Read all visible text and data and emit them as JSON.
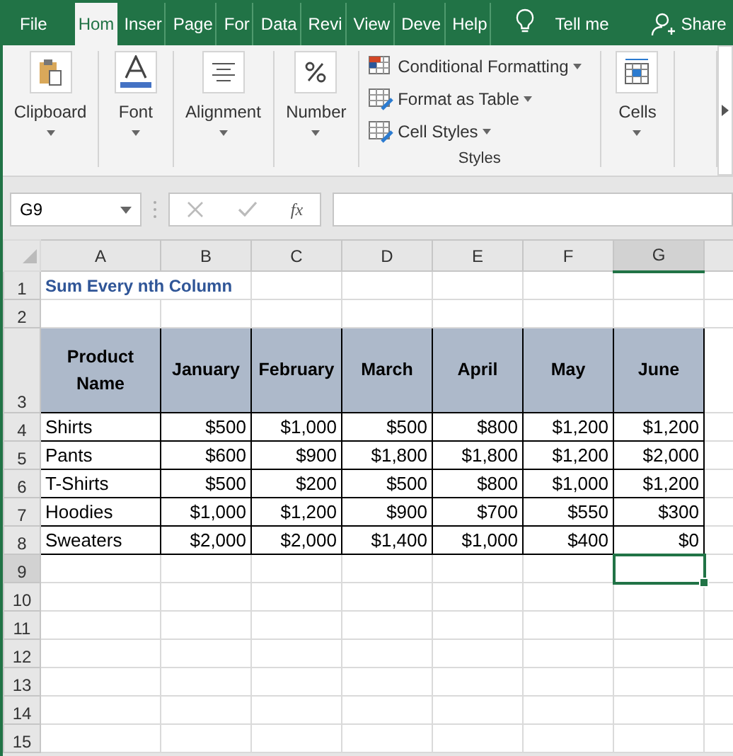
{
  "ribbon_tabs": [
    {
      "label": "File",
      "selected": false
    },
    {
      "label": "Hom",
      "selected": true
    },
    {
      "label": "Inser",
      "selected": false
    },
    {
      "label": "Page",
      "selected": false
    },
    {
      "label": "For",
      "selected": false
    },
    {
      "label": "Data",
      "selected": false
    },
    {
      "label": "Revi",
      "selected": false
    },
    {
      "label": "View",
      "selected": false
    },
    {
      "label": "Deve",
      "selected": false
    },
    {
      "label": "Help",
      "selected": false
    }
  ],
  "tell_me": "Tell me",
  "share": "Share",
  "ribbon_groups": [
    {
      "kind": "clipboard",
      "label": "Clipboard"
    },
    {
      "kind": "font",
      "label": "Font"
    },
    {
      "kind": "alignment",
      "label": "Alignment"
    },
    {
      "kind": "number",
      "label": "Number"
    },
    {
      "kind": "styles",
      "label": "Styles",
      "items": [
        "Conditional Formatting",
        "Format as Table",
        "Cell Styles"
      ]
    },
    {
      "kind": "cells",
      "label": "Cells"
    }
  ],
  "name_box": "G9",
  "function_symbol": "fx",
  "sheet": {
    "columns": [
      {
        "label": "A",
        "selected": false
      },
      {
        "label": "B",
        "selected": false
      },
      {
        "label": "C",
        "selected": false
      },
      {
        "label": "D",
        "selected": false
      },
      {
        "label": "E",
        "selected": false
      },
      {
        "label": "F",
        "selected": false
      },
      {
        "label": "G",
        "selected": true
      }
    ],
    "rows": [
      {
        "number": "1",
        "selected": false,
        "kind": "title",
        "cells": [
          "Sum Every nth Column"
        ]
      },
      {
        "number": "2",
        "selected": false,
        "kind": "blank"
      },
      {
        "number": "3",
        "selected": false,
        "kind": "header",
        "cells": [
          "Product Name",
          "January",
          "February",
          "March",
          "April",
          "May",
          "June"
        ]
      },
      {
        "number": "4",
        "selected": false,
        "kind": "data",
        "cells": [
          "Shirts",
          "$500",
          "$1,000",
          "$500",
          "$800",
          "$1,200",
          "$1,200"
        ]
      },
      {
        "number": "5",
        "selected": false,
        "kind": "data",
        "cells": [
          "Pants",
          "$600",
          "$900",
          "$1,800",
          "$1,800",
          "$1,200",
          "$2,000"
        ]
      },
      {
        "number": "6",
        "selected": false,
        "kind": "data",
        "cells": [
          "T-Shirts",
          "$500",
          "$200",
          "$500",
          "$800",
          "$1,000",
          "$1,200"
        ]
      },
      {
        "number": "7",
        "selected": false,
        "kind": "data",
        "cells": [
          "Hoodies",
          "$1,000",
          "$1,200",
          "$900",
          "$700",
          "$550",
          "$300"
        ]
      },
      {
        "number": "8",
        "selected": false,
        "kind": "data",
        "cells": [
          "Sweaters",
          "$2,000",
          "$2,000",
          "$1,400",
          "$1,000",
          "$400",
          "$0"
        ]
      },
      {
        "number": "9",
        "selected": true,
        "kind": "blank"
      },
      {
        "number": "10",
        "selected": false,
        "kind": "blank"
      },
      {
        "number": "11",
        "selected": false,
        "kind": "blank"
      },
      {
        "number": "12",
        "selected": false,
        "kind": "blank"
      },
      {
        "number": "13",
        "selected": false,
        "kind": "blank"
      },
      {
        "number": "14",
        "selected": false,
        "kind": "blank"
      },
      {
        "number": "15",
        "selected": false,
        "kind": "blank"
      }
    ]
  }
}
